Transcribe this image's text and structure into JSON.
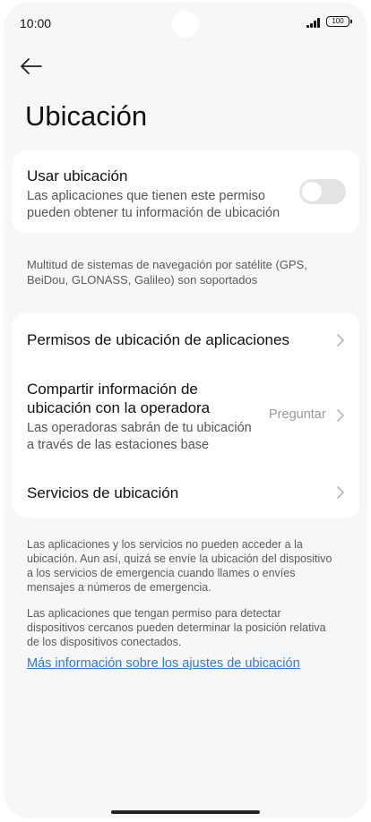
{
  "status_bar": {
    "time": "10:00",
    "battery": "100"
  },
  "header": {
    "title": "Ubicación",
    "back_icon": "arrow-left-icon"
  },
  "location_card": {
    "title": "Usar ubicación",
    "subtitle_line1": "Las aplicaciones que tienen este permiso",
    "subtitle_line2": "pueden obtener tu información de ubicación",
    "toggle_on": false
  },
  "gnss_note": "Multitud de sistemas de navegación por satélite (GPS, BeiDou, GLONASS, Galileo) son soportados",
  "settings": {
    "app_permissions": "Permisos de ubicación de aplicaciones",
    "carrier_title_line1": "Compartir información de",
    "carrier_title_line2": "ubicación con la operadora",
    "carrier_sub_line1": "Las operadoras sabrán de tu ubicación",
    "carrier_sub_line2": "a través de las estaciones base",
    "carrier_value": "Preguntar",
    "location_services": "Servicios de ubicación"
  },
  "footer": {
    "emergency_note": "Las aplicaciones y los servicios no pueden acceder a la ubicación. Aun así, quizá se envíe la ubicación del dispositivo a los servicios de emergencia cuando llames o envíes mensajes a números de emergencia.",
    "nearby_note": "Las aplicaciones que tengan permiso para detectar dispositivos cercanos pueden determinar la posición relativa de los dispositivos conectados.",
    "more_info_link": "Más información sobre los ajustes de ubicación"
  },
  "colors": {
    "link": "#2f7bd8",
    "background": "#f7f7f7",
    "card": "#ffffff",
    "toggle_off": "#e3e3e3"
  }
}
